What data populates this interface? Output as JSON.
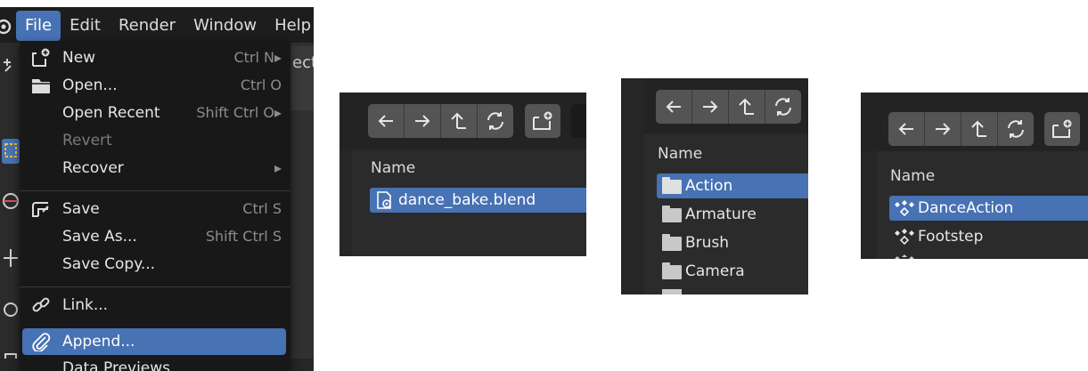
{
  "menubar": {
    "items": [
      "File",
      "Edit",
      "Render",
      "Window",
      "Help"
    ],
    "active_index": 0
  },
  "behind_text": "ect",
  "file_menu": {
    "items": [
      {
        "label": "New",
        "shortcut": "Ctrl N",
        "icon": "new-file-icon",
        "submenu": true
      },
      {
        "label": "Open...",
        "shortcut": "Ctrl O",
        "icon": "folder-icon"
      },
      {
        "label": "Open Recent",
        "shortcut": "Shift Ctrl O",
        "submenu": true
      },
      {
        "label": "Revert",
        "disabled": true
      },
      {
        "label": "Recover",
        "submenu": true
      },
      {
        "label": "Save",
        "shortcut": "Ctrl S",
        "icon": "save-icon"
      },
      {
        "label": "Save As...",
        "shortcut": "Shift Ctrl S"
      },
      {
        "label": "Save Copy..."
      },
      {
        "label": "Link...",
        "icon": "link-icon"
      },
      {
        "label": "Append...",
        "icon": "paperclip-icon",
        "highlighted": true
      },
      {
        "label": "Data Previews",
        "submenu": true
      }
    ]
  },
  "browser_blend": {
    "column_header": "Name",
    "rows": [
      {
        "label": "dance_bake.blend",
        "selected": true,
        "icon": "blend-file-icon"
      }
    ]
  },
  "browser_datablocks": {
    "column_header": "Name",
    "rows": [
      {
        "label": "Action",
        "selected": true,
        "icon": "folder-icon"
      },
      {
        "label": "Armature",
        "icon": "folder-icon"
      },
      {
        "label": "Brush",
        "icon": "folder-icon"
      },
      {
        "label": "Camera",
        "icon": "folder-icon"
      }
    ]
  },
  "browser_actions": {
    "column_header": "Name",
    "rows": [
      {
        "label": "DanceAction",
        "selected": true,
        "icon": "action-icon"
      },
      {
        "label": "Footstep",
        "icon": "action-icon"
      }
    ]
  },
  "colors": {
    "highlight": "#4772b3",
    "menu_bg": "#181818",
    "panel_bg": "#2b2b2b",
    "button_bg": "#545454"
  }
}
